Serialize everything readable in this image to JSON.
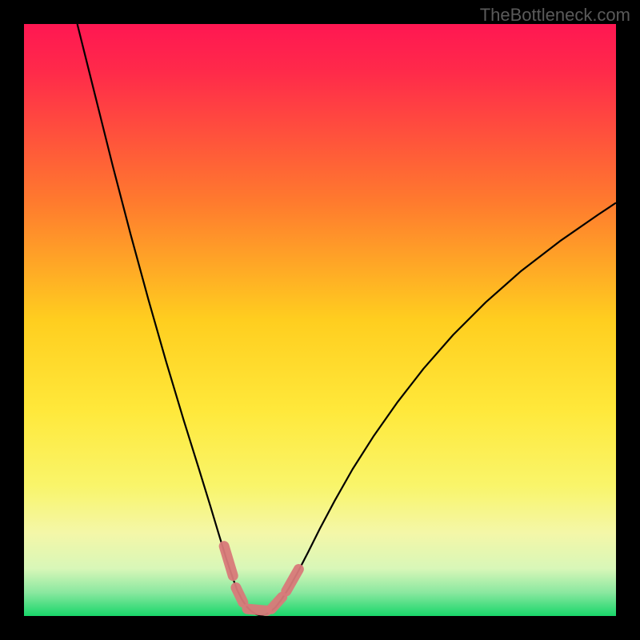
{
  "watermark": "TheBottleneck.com",
  "chart_data": {
    "type": "line",
    "title": "",
    "xlabel": "",
    "ylabel": "",
    "xlim": [
      0,
      100
    ],
    "ylim": [
      0,
      100
    ],
    "background_gradient": {
      "stops": [
        {
          "offset": 0.0,
          "color": "#ff1752"
        },
        {
          "offset": 0.08,
          "color": "#ff2a4a"
        },
        {
          "offset": 0.3,
          "color": "#ff7a2e"
        },
        {
          "offset": 0.5,
          "color": "#ffce1f"
        },
        {
          "offset": 0.65,
          "color": "#ffe83a"
        },
        {
          "offset": 0.78,
          "color": "#f9f56a"
        },
        {
          "offset": 0.86,
          "color": "#f4f7a8"
        },
        {
          "offset": 0.92,
          "color": "#d8f7b8"
        },
        {
          "offset": 0.96,
          "color": "#8be8a0"
        },
        {
          "offset": 1.0,
          "color": "#18d66a"
        }
      ]
    },
    "series": [
      {
        "name": "left-curve",
        "stroke": "#000000",
        "stroke_width": 2.2,
        "points": [
          {
            "x": 9.0,
            "y": 100.0
          },
          {
            "x": 12.0,
            "y": 88.0
          },
          {
            "x": 15.0,
            "y": 76.0
          },
          {
            "x": 18.0,
            "y": 64.5
          },
          {
            "x": 21.0,
            "y": 53.5
          },
          {
            "x": 24.0,
            "y": 43.0
          },
          {
            "x": 27.0,
            "y": 33.0
          },
          {
            "x": 29.5,
            "y": 25.0
          },
          {
            "x": 31.5,
            "y": 18.5
          },
          {
            "x": 33.0,
            "y": 13.5
          },
          {
            "x": 34.2,
            "y": 9.6
          },
          {
            "x": 35.2,
            "y": 6.6
          },
          {
            "x": 36.0,
            "y": 4.4
          },
          {
            "x": 36.8,
            "y": 2.8
          },
          {
            "x": 37.6,
            "y": 1.6
          },
          {
            "x": 38.4,
            "y": 0.8
          },
          {
            "x": 39.2,
            "y": 0.3
          },
          {
            "x": 40.0,
            "y": 0.05
          }
        ]
      },
      {
        "name": "right-curve",
        "stroke": "#000000",
        "stroke_width": 2.2,
        "points": [
          {
            "x": 40.0,
            "y": 0.05
          },
          {
            "x": 40.8,
            "y": 0.25
          },
          {
            "x": 41.6,
            "y": 0.7
          },
          {
            "x": 42.5,
            "y": 1.5
          },
          {
            "x": 43.5,
            "y": 2.8
          },
          {
            "x": 44.8,
            "y": 4.8
          },
          {
            "x": 46.3,
            "y": 7.5
          },
          {
            "x": 48.0,
            "y": 10.8
          },
          {
            "x": 50.0,
            "y": 14.8
          },
          {
            "x": 52.5,
            "y": 19.5
          },
          {
            "x": 55.5,
            "y": 24.8
          },
          {
            "x": 59.0,
            "y": 30.3
          },
          {
            "x": 63.0,
            "y": 36.0
          },
          {
            "x": 67.5,
            "y": 41.8
          },
          {
            "x": 72.5,
            "y": 47.5
          },
          {
            "x": 78.0,
            "y": 53.0
          },
          {
            "x": 84.0,
            "y": 58.3
          },
          {
            "x": 90.5,
            "y": 63.3
          },
          {
            "x": 97.0,
            "y": 67.8
          },
          {
            "x": 100.0,
            "y": 69.8
          }
        ]
      },
      {
        "name": "marker-overlay",
        "stroke": "#d97a7a",
        "stroke_width": 13,
        "linecap": "round",
        "segments": [
          {
            "from": {
              "x": 33.8,
              "y": 11.8
            },
            "to": {
              "x": 35.3,
              "y": 6.8
            }
          },
          {
            "from": {
              "x": 35.8,
              "y": 4.8
            },
            "to": {
              "x": 37.0,
              "y": 2.3
            }
          },
          {
            "from": {
              "x": 37.7,
              "y": 1.2
            },
            "to": {
              "x": 41.0,
              "y": 0.9
            }
          },
          {
            "from": {
              "x": 41.8,
              "y": 1.2
            },
            "to": {
              "x": 43.6,
              "y": 3.2
            }
          },
          {
            "from": {
              "x": 44.3,
              "y": 4.2
            },
            "to": {
              "x": 46.4,
              "y": 7.9
            }
          }
        ]
      }
    ]
  }
}
